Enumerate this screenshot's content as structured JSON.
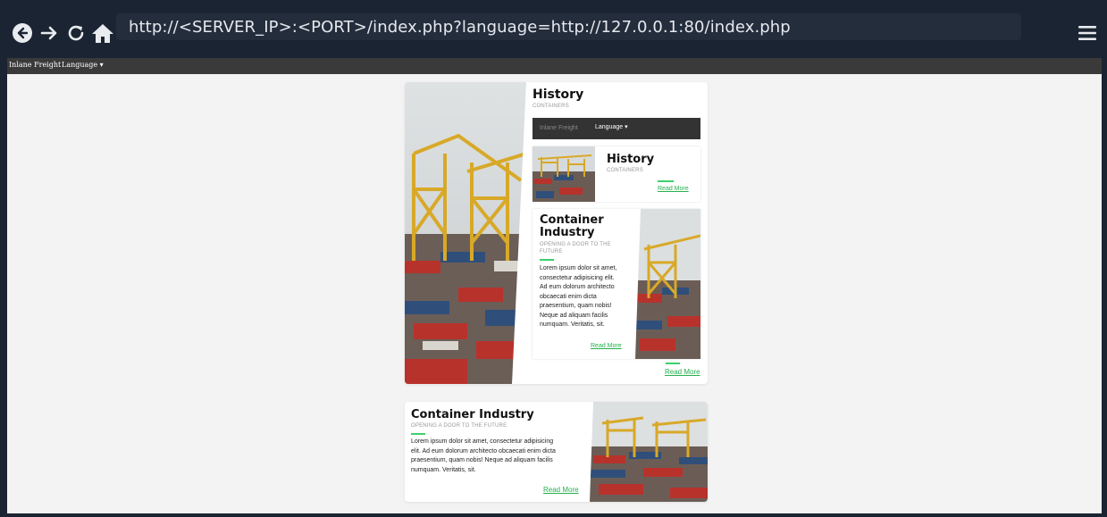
{
  "browser": {
    "url": "http://<SERVER_IP>:<PORT>/index.php?language=http://127.0.0.1:80/index.php",
    "icons": [
      "back-icon",
      "forward-icon",
      "reload-icon",
      "home-icon",
      "hamburger-menu-icon"
    ]
  },
  "site_nav": {
    "brand": "Inlane Freight",
    "language": "Language ▾"
  },
  "card1": {
    "title": "History",
    "subtitle": "CONTAINERS",
    "inner_nav": {
      "brand": "Inlane Freight",
      "language": "Language ▾"
    },
    "inner_history": {
      "title": "History",
      "subtitle": "CONTAINERS",
      "read_more": "Read More"
    },
    "inner_industry": {
      "title_line1": "Container",
      "title_line2": "Industry",
      "subtitle_line1": "OPENING A DOOR TO THE",
      "subtitle_line2": "FUTURE",
      "body_lines": [
        "Lorem ipsum dolor sit amet,",
        "consectetur adipisicing elit.",
        "Ad eum dolorum architecto",
        "obcaecati enim dicta",
        "praesentium, quam nobis!",
        "Neque ad aliquam facilis",
        "numquam. Veritatis, sit."
      ],
      "read_more": "Read More"
    },
    "read_more": "Read More"
  },
  "card2": {
    "title": "Container Industry",
    "subtitle": "OPENING A DOOR TO THE FUTURE",
    "body_lines": [
      "Lorem ipsum dolor sit amet, consectetur adipisicing",
      "elit. Ad eum dolorum architecto obcaecati enim dicta",
      "praesentium, quam nobis! Neque ad aliquam facilis",
      "numquam. Veritatis, sit."
    ],
    "read_more": "Read More"
  },
  "colors": {
    "accent": "#3ecf6b",
    "chrome": "#1b2432",
    "page_bg": "#f3f3f3",
    "nav_bg": "#3a3a3a"
  }
}
